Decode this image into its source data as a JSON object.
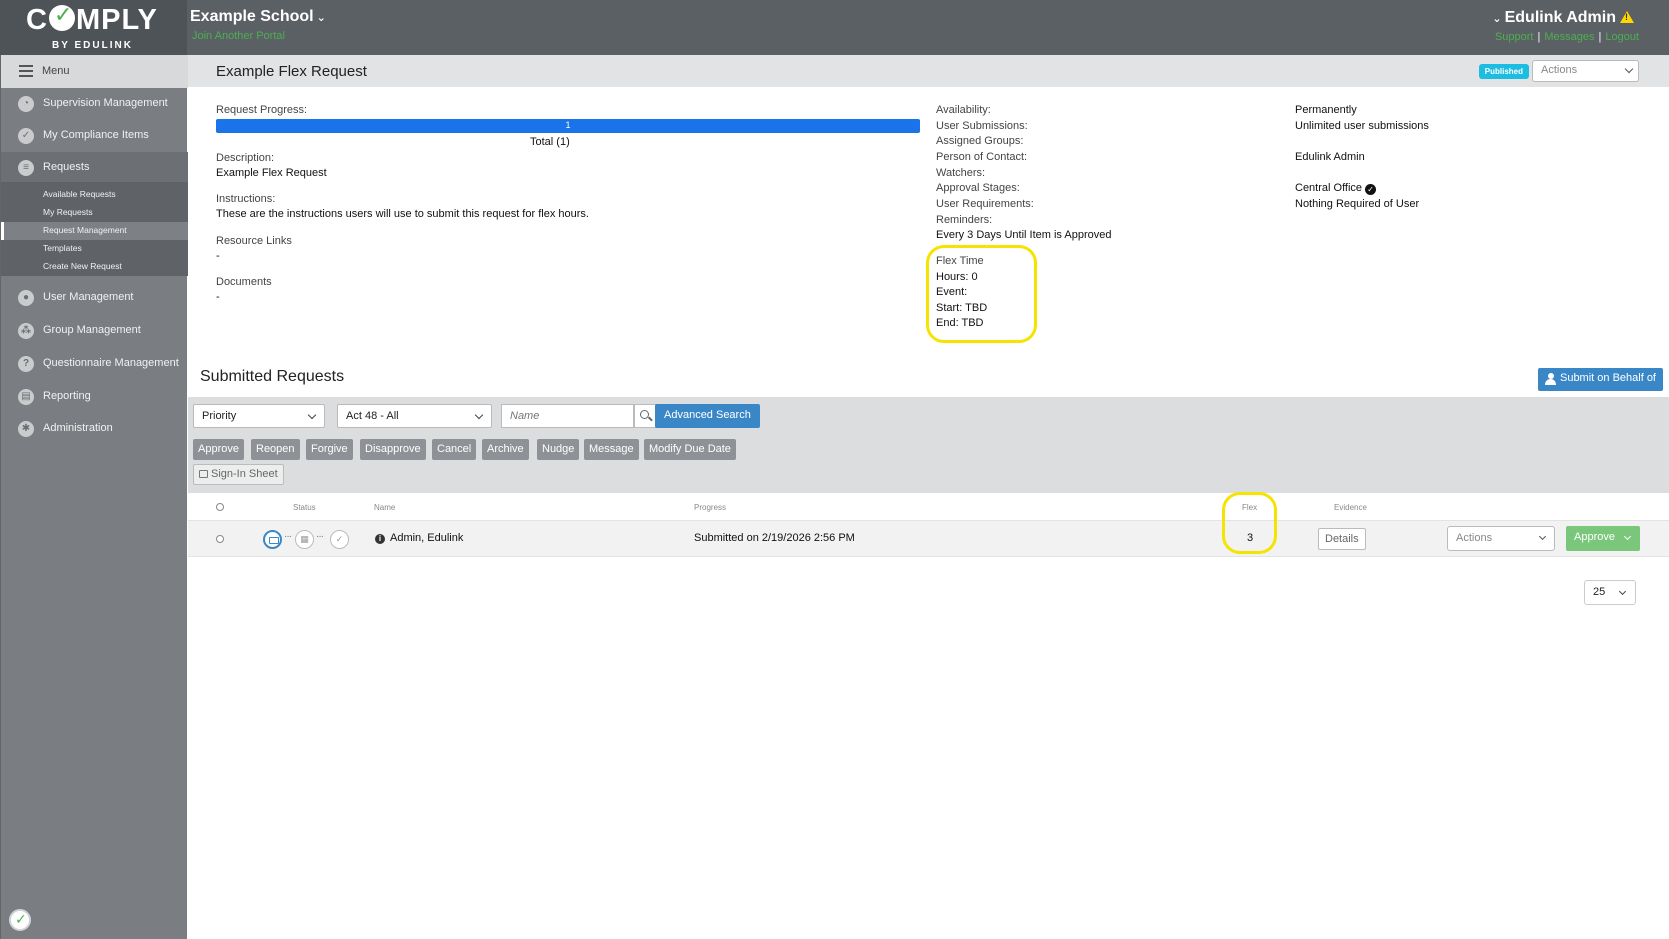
{
  "header": {
    "logo_main": "C",
    "logo_main_rest": "MPLY",
    "logo_sub": "BY EDULINK",
    "school_name": "Example School",
    "join_portal": "Join Another Portal",
    "admin_name": "Edulink Admin",
    "links": {
      "support": "Support",
      "messages": "Messages",
      "logout": "Logout",
      "separator": "|"
    }
  },
  "sidebar": {
    "menu_label": "Menu",
    "items": [
      {
        "label": "Supervision Management",
        "icon": "gauge-icon"
      },
      {
        "label": "My Compliance Items",
        "icon": "check-icon"
      },
      {
        "label": "Requests",
        "icon": "document-icon"
      },
      {
        "label": "User Management",
        "icon": "user-icon"
      },
      {
        "label": "Group Management",
        "icon": "group-icon"
      },
      {
        "label": "Questionnaire Management",
        "icon": "question-icon"
      },
      {
        "label": "Reporting",
        "icon": "report-icon"
      },
      {
        "label": "Administration",
        "icon": "gear-icon"
      }
    ],
    "request_subitems": [
      {
        "label": "Available Requests"
      },
      {
        "label": "My Requests"
      },
      {
        "label": "Request Management"
      },
      {
        "label": "Templates"
      },
      {
        "label": "Create New Request"
      }
    ]
  },
  "page": {
    "title": "Example Flex Request",
    "status_badge": "Published",
    "actions_label": "Actions"
  },
  "details": {
    "progress_label": "Request Progress:",
    "progress_value": "1",
    "progress_fraction": 1.0,
    "progress_total": "Total (1)",
    "description_label": "Description:",
    "description": "Example Flex Request",
    "instructions_label": "Instructions:",
    "instructions": "These are the instructions users will use to submit this request for flex hours.",
    "resource_links_label": "Resource Links",
    "resource_links": "-",
    "documents_label": "Documents",
    "documents": "-",
    "availability_label": "Availability:",
    "availability": "Permanently",
    "user_submissions_label": "User Submissions:",
    "user_submissions": "Unlimited user submissions",
    "assigned_groups_label": "Assigned Groups:",
    "person_of_contact_label": "Person of Contact:",
    "person_of_contact": "Edulink Admin",
    "watchers_label": "Watchers:",
    "approval_stages_label": "Approval Stages:",
    "approval_stages": "Central Office",
    "user_requirements_label": "User Requirements:",
    "user_requirements": "Nothing Required of User",
    "reminders_label": "Reminders:",
    "reminders": "Every 3 Days Until Item is Approved",
    "flex_title": "Flex Time",
    "flex_hours": "Hours: 0",
    "flex_event": "Event:",
    "flex_start": "Start: TBD",
    "flex_end": "End: TBD"
  },
  "submitted": {
    "title": "Submitted Requests",
    "submit_on_behalf": "Submit on Behalf of",
    "filters": {
      "priority": "Priority",
      "group": "Act 48 - All",
      "name_placeholder": "Name",
      "advanced_search": "Advanced Search"
    },
    "bulk_actions": [
      "Approve",
      "Reopen",
      "Forgive",
      "Disapprove",
      "Cancel",
      "Archive",
      "Nudge",
      "Message",
      "Modify Due Date"
    ],
    "sign_in_sheet": "Sign-In Sheet",
    "columns": {
      "status": "Status",
      "name": "Name",
      "progress": "Progress",
      "flex": "Flex",
      "evidence": "Evidence"
    },
    "rows": [
      {
        "name": "Admin, Edulink",
        "progress": "Submitted on 2/19/2026 2:56 PM",
        "flex": "3",
        "details": "Details",
        "actions": "Actions",
        "approve": "Approve",
        "dots": "···"
      }
    ],
    "page_size": "25"
  },
  "colors": {
    "accent_blue": "#3a87c8",
    "progress_blue": "#1a73e8",
    "link_green": "#4caf50",
    "highlight_yellow": "#f5e400",
    "badge_cyan": "#1cbde0"
  }
}
